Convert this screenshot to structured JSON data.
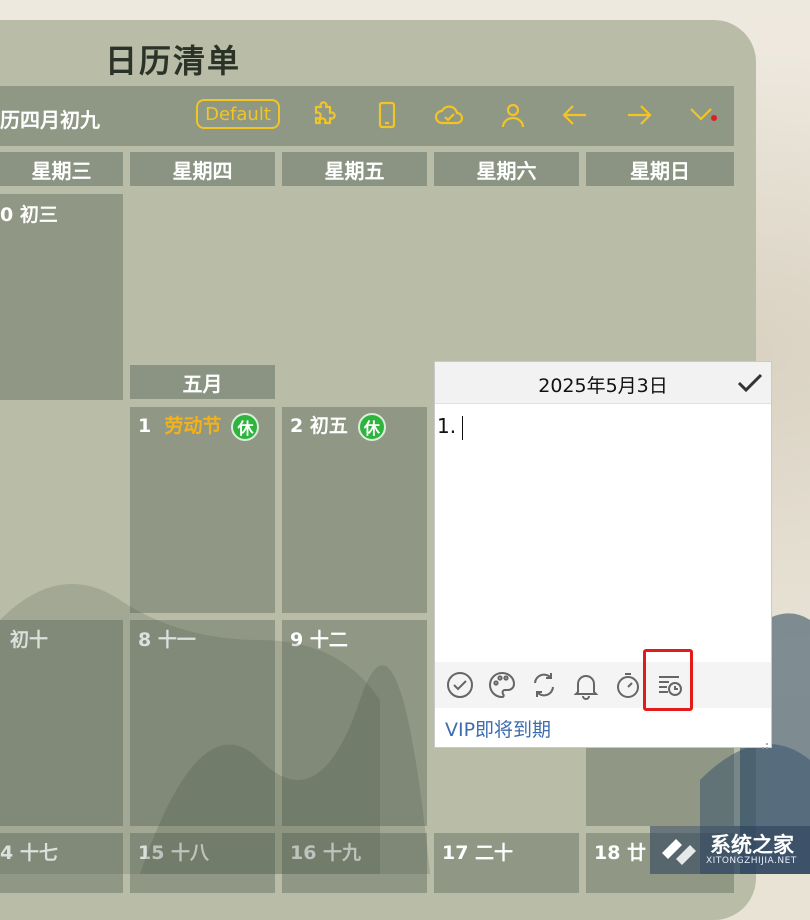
{
  "app": {
    "title": "日历清单"
  },
  "toolbar": {
    "lunar_date": "历四月初九",
    "default_label": "Default",
    "icons": [
      "puzzle-icon",
      "phone-icon",
      "cloud-sync-icon",
      "user-icon",
      "arrow-left-icon",
      "arrow-right-icon",
      "chevron-down-icon"
    ],
    "accent_color": "#f3c425"
  },
  "weekdays": [
    "星期三",
    "星期四",
    "星期五",
    "星期六",
    "星期日"
  ],
  "calendar": {
    "month_label": "五月",
    "cells": {
      "apr30": "0  初三",
      "may1_num": "1",
      "may1_name": "劳动节",
      "may1_badge": "休",
      "may2": "2  初五",
      "may2_badge": "休",
      "may7": "初十",
      "may8": "8  十一",
      "may9": "9  十二",
      "may14": "4  十七",
      "may15": "15  十八",
      "may16": "16  十九",
      "may17": "17  二十",
      "may18": "18  廿"
    }
  },
  "note": {
    "date": "2025年5月3日",
    "body": "1.",
    "tools": [
      "check-circle-icon",
      "palette-icon",
      "repeat-icon",
      "bell-icon",
      "stopwatch-icon",
      "list-clock-icon"
    ],
    "vip_text": "VIP即将到期"
  },
  "watermark": {
    "text": "系统之家",
    "sub": "XITONGZHIJIA.NET"
  }
}
